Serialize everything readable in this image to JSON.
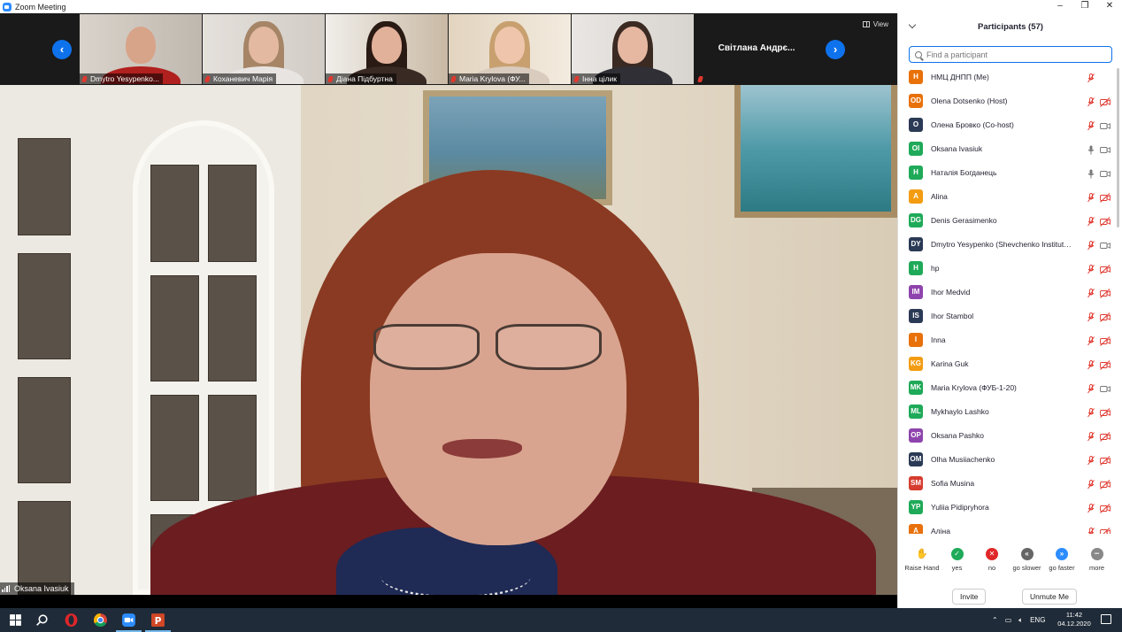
{
  "window": {
    "title": "Zoom Meeting",
    "controls": [
      "minimize-icon",
      "maximize-icon",
      "close-icon"
    ]
  },
  "gallery_strip": {
    "thumbnails": [
      {
        "name": "Dmytro Yesypenko..."
      },
      {
        "name": "Коханевич Марія"
      },
      {
        "name": "Діана Підбуртна"
      },
      {
        "name": "Maria Krylova (ФУ..."
      },
      {
        "name": "Інна цілик"
      }
    ],
    "name_tile": "Світлана Андрє...",
    "view_label": "View"
  },
  "active_speaker": {
    "name": "Oksana Ivasiuk"
  },
  "participants_panel": {
    "title": "Participants (57)",
    "search_placeholder": "Find a participant",
    "participants": [
      {
        "initials": "H",
        "name": "НМЦ ДНПП (Me)",
        "color": "#e8710a",
        "mic": "muted",
        "cam": "none"
      },
      {
        "initials": "OD",
        "name": "Olena Dotsenko (Host)",
        "color": "#e8710a",
        "mic": "muted",
        "cam": "off"
      },
      {
        "initials": "O",
        "name": "Олена Бровко (Co-host)",
        "color": "#2b3a55",
        "mic": "muted",
        "cam": "on"
      },
      {
        "initials": "OI",
        "name": "Oksana Ivasiuk",
        "color": "#1faa59",
        "mic": "on",
        "cam": "on"
      },
      {
        "initials": "H",
        "name": "Наталія Богданець",
        "color": "#1faa59",
        "mic": "on",
        "cam": "on"
      },
      {
        "initials": "A",
        "name": "Alina",
        "color": "#f39c12",
        "mic": "muted",
        "cam": "off"
      },
      {
        "initials": "DG",
        "name": "Denis Gerasimenko",
        "color": "#1faa59",
        "mic": "muted",
        "cam": "off"
      },
      {
        "initials": "DY",
        "name": "Dmytro Yesypenko (Shevchenko Institute of...",
        "color": "#2b3a55",
        "mic": "muted",
        "cam": "on"
      },
      {
        "initials": "H",
        "name": "hp",
        "color": "#1faa59",
        "mic": "muted",
        "cam": "off"
      },
      {
        "initials": "IM",
        "name": "Ihor Medvid",
        "color": "#8e44ad",
        "mic": "muted",
        "cam": "off"
      },
      {
        "initials": "IS",
        "name": "Ihor Stambol",
        "color": "#2b3a55",
        "mic": "muted",
        "cam": "off"
      },
      {
        "initials": "I",
        "name": "Inna",
        "color": "#e8710a",
        "mic": "muted",
        "cam": "off"
      },
      {
        "initials": "KG",
        "name": "Karina Guk",
        "color": "#f39c12",
        "mic": "muted",
        "cam": "off"
      },
      {
        "initials": "MK",
        "name": "Maria Krylova (ФУБ-1-20)",
        "color": "#1faa59",
        "mic": "muted",
        "cam": "on"
      },
      {
        "initials": "ML",
        "name": "Mykhaylo Lashko",
        "color": "#1faa59",
        "mic": "muted",
        "cam": "off"
      },
      {
        "initials": "OP",
        "name": "Oksana Pashko",
        "color": "#8e44ad",
        "mic": "muted",
        "cam": "off"
      },
      {
        "initials": "OM",
        "name": "Olha Musiiachenko",
        "color": "#2b3a55",
        "mic": "muted",
        "cam": "off"
      },
      {
        "initials": "SM",
        "name": "Sofia Musina",
        "color": "#d63c2f",
        "mic": "muted",
        "cam": "off"
      },
      {
        "initials": "YP",
        "name": "Yuliia Pidipryhora",
        "color": "#1faa59",
        "mic": "muted",
        "cam": "off"
      },
      {
        "initials": "A",
        "name": "Аліна",
        "color": "#e8710a",
        "mic": "muted",
        "cam": "off"
      }
    ],
    "reactions": [
      {
        "label": "Raise Hand",
        "icon": "raise-hand-icon",
        "color": "#2d8cff",
        "glyph": "✋"
      },
      {
        "label": "yes",
        "icon": "yes-icon",
        "color": "#1faa59",
        "glyph": "✓"
      },
      {
        "label": "no",
        "icon": "no-icon",
        "color": "#e02828",
        "glyph": "✕"
      },
      {
        "label": "go slower",
        "icon": "go-slower-icon",
        "color": "#666666",
        "glyph": "«"
      },
      {
        "label": "go faster",
        "icon": "go-faster-icon",
        "color": "#2d8cff",
        "glyph": "»"
      },
      {
        "label": "more",
        "icon": "more-icon",
        "color": "#888888",
        "glyph": "•••"
      }
    ],
    "invite_label": "Invite",
    "unmute_label": "Unmute Me"
  },
  "taskbar": {
    "apps": [
      "windows-start-icon",
      "search-icon",
      "opera-icon",
      "chrome-icon",
      "zoom-icon",
      "powerpoint-icon"
    ],
    "language": "ENG",
    "time": "11:42",
    "date": "04.12.2020"
  },
  "colors": {
    "accent": "#0e72ed",
    "muted_red": "#e0382f",
    "taskbar": "#1f2b38"
  }
}
